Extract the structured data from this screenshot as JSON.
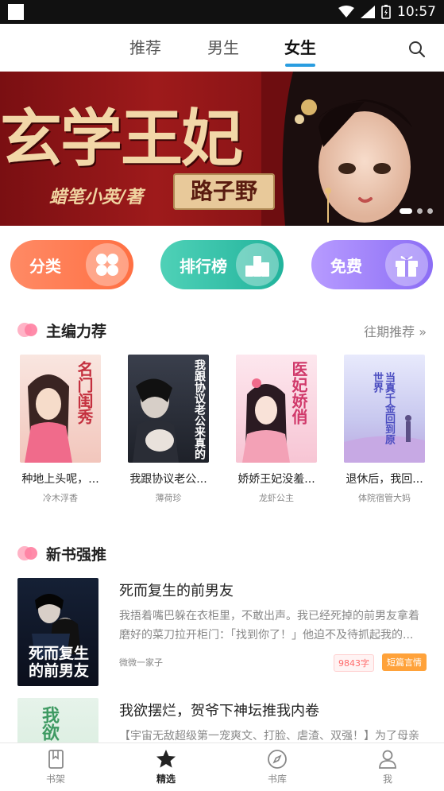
{
  "status": {
    "time": "10:57"
  },
  "topnav": {
    "tabs": [
      {
        "label": "推荐"
      },
      {
        "label": "男生"
      },
      {
        "label": "女生"
      }
    ]
  },
  "banner": {
    "title": "玄学王妃",
    "author": "蜡笔小英/著",
    "plate": "路子野"
  },
  "quick": [
    {
      "label": "分类"
    },
    {
      "label": "排行榜"
    },
    {
      "label": "免费"
    }
  ],
  "editors": {
    "title": "主编力荐",
    "more": "往期推荐 »",
    "books": [
      {
        "title": "种地上头呢，...",
        "author": "冷木浮香",
        "cover_text": "名门闺秀"
      },
      {
        "title": "我跟协议老公...",
        "author": "薄荷珍",
        "cover_text": "我跟协议老公来真的"
      },
      {
        "title": "娇娇王妃没羞...",
        "author": "龙虾公主",
        "cover_text": "医妃娇俏"
      },
      {
        "title": "退休后，我回...",
        "author": "体院宿管大妈",
        "cover_text": "当真千金回到原世界"
      }
    ]
  },
  "newbooks": {
    "title": "新书强推",
    "items": [
      {
        "title": "死而复生的前男友",
        "desc": "我捂着嘴巴躲在衣柜里，不敢出声。我已经死掉的前男友拿着磨好的菜刀拉开柜门：「找到你了！」他迫不及待抓起我的...",
        "author": "微微一家子",
        "words": "9843字",
        "tag": "短篇言情",
        "cover_text": "死而复生的前男友"
      },
      {
        "title": "我欲摆烂，贺爷下神坛推我内卷",
        "desc": "【宇宙无敌超级第一宠爽文、打脸、虐渣、双强！】为了母亲",
        "cover_text": "我欲"
      }
    ]
  },
  "bottomnav": {
    "items": [
      {
        "label": "书架"
      },
      {
        "label": "精选"
      },
      {
        "label": "书库"
      },
      {
        "label": "我"
      }
    ]
  }
}
